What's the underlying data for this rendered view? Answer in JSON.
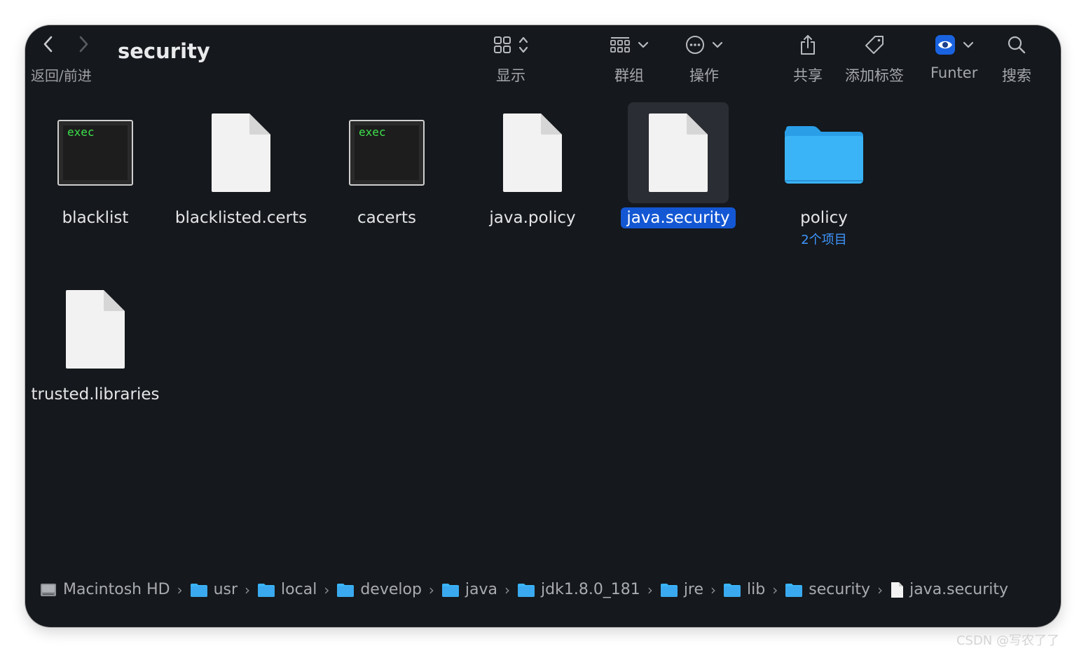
{
  "window": {
    "title": "security"
  },
  "toolbar": {
    "nav_label": "返回/前进",
    "display_label": "显示",
    "group_label": "群组",
    "action_label": "操作",
    "share_label": "共享",
    "tag_label": "添加标签",
    "funter_label": "Funter",
    "search_label": "搜索"
  },
  "files": [
    {
      "name": "blacklist",
      "kind": "exec",
      "badge": "exec"
    },
    {
      "name": "blacklisted.certs",
      "kind": "document"
    },
    {
      "name": "cacerts",
      "kind": "exec",
      "badge": "exec"
    },
    {
      "name": "java.policy",
      "kind": "document"
    },
    {
      "name": "java.security",
      "kind": "document",
      "selected": true
    },
    {
      "name": "policy",
      "kind": "folder",
      "sub": "2个项目"
    },
    {
      "name": "trusted.libraries",
      "kind": "document"
    }
  ],
  "path": [
    "Macintosh HD",
    "usr",
    "local",
    "develop",
    "java",
    "jdk1.8.0_181",
    "jre",
    "lib",
    "security",
    "java.security"
  ],
  "watermark": "CSDN @写农了了",
  "colors": {
    "window_bg": "#15181c",
    "selection": "#1357d4",
    "folder": "#3ab4f7",
    "sub_text": "#3f96ff",
    "exec_text": "#3de24b"
  },
  "path_separator": "›"
}
